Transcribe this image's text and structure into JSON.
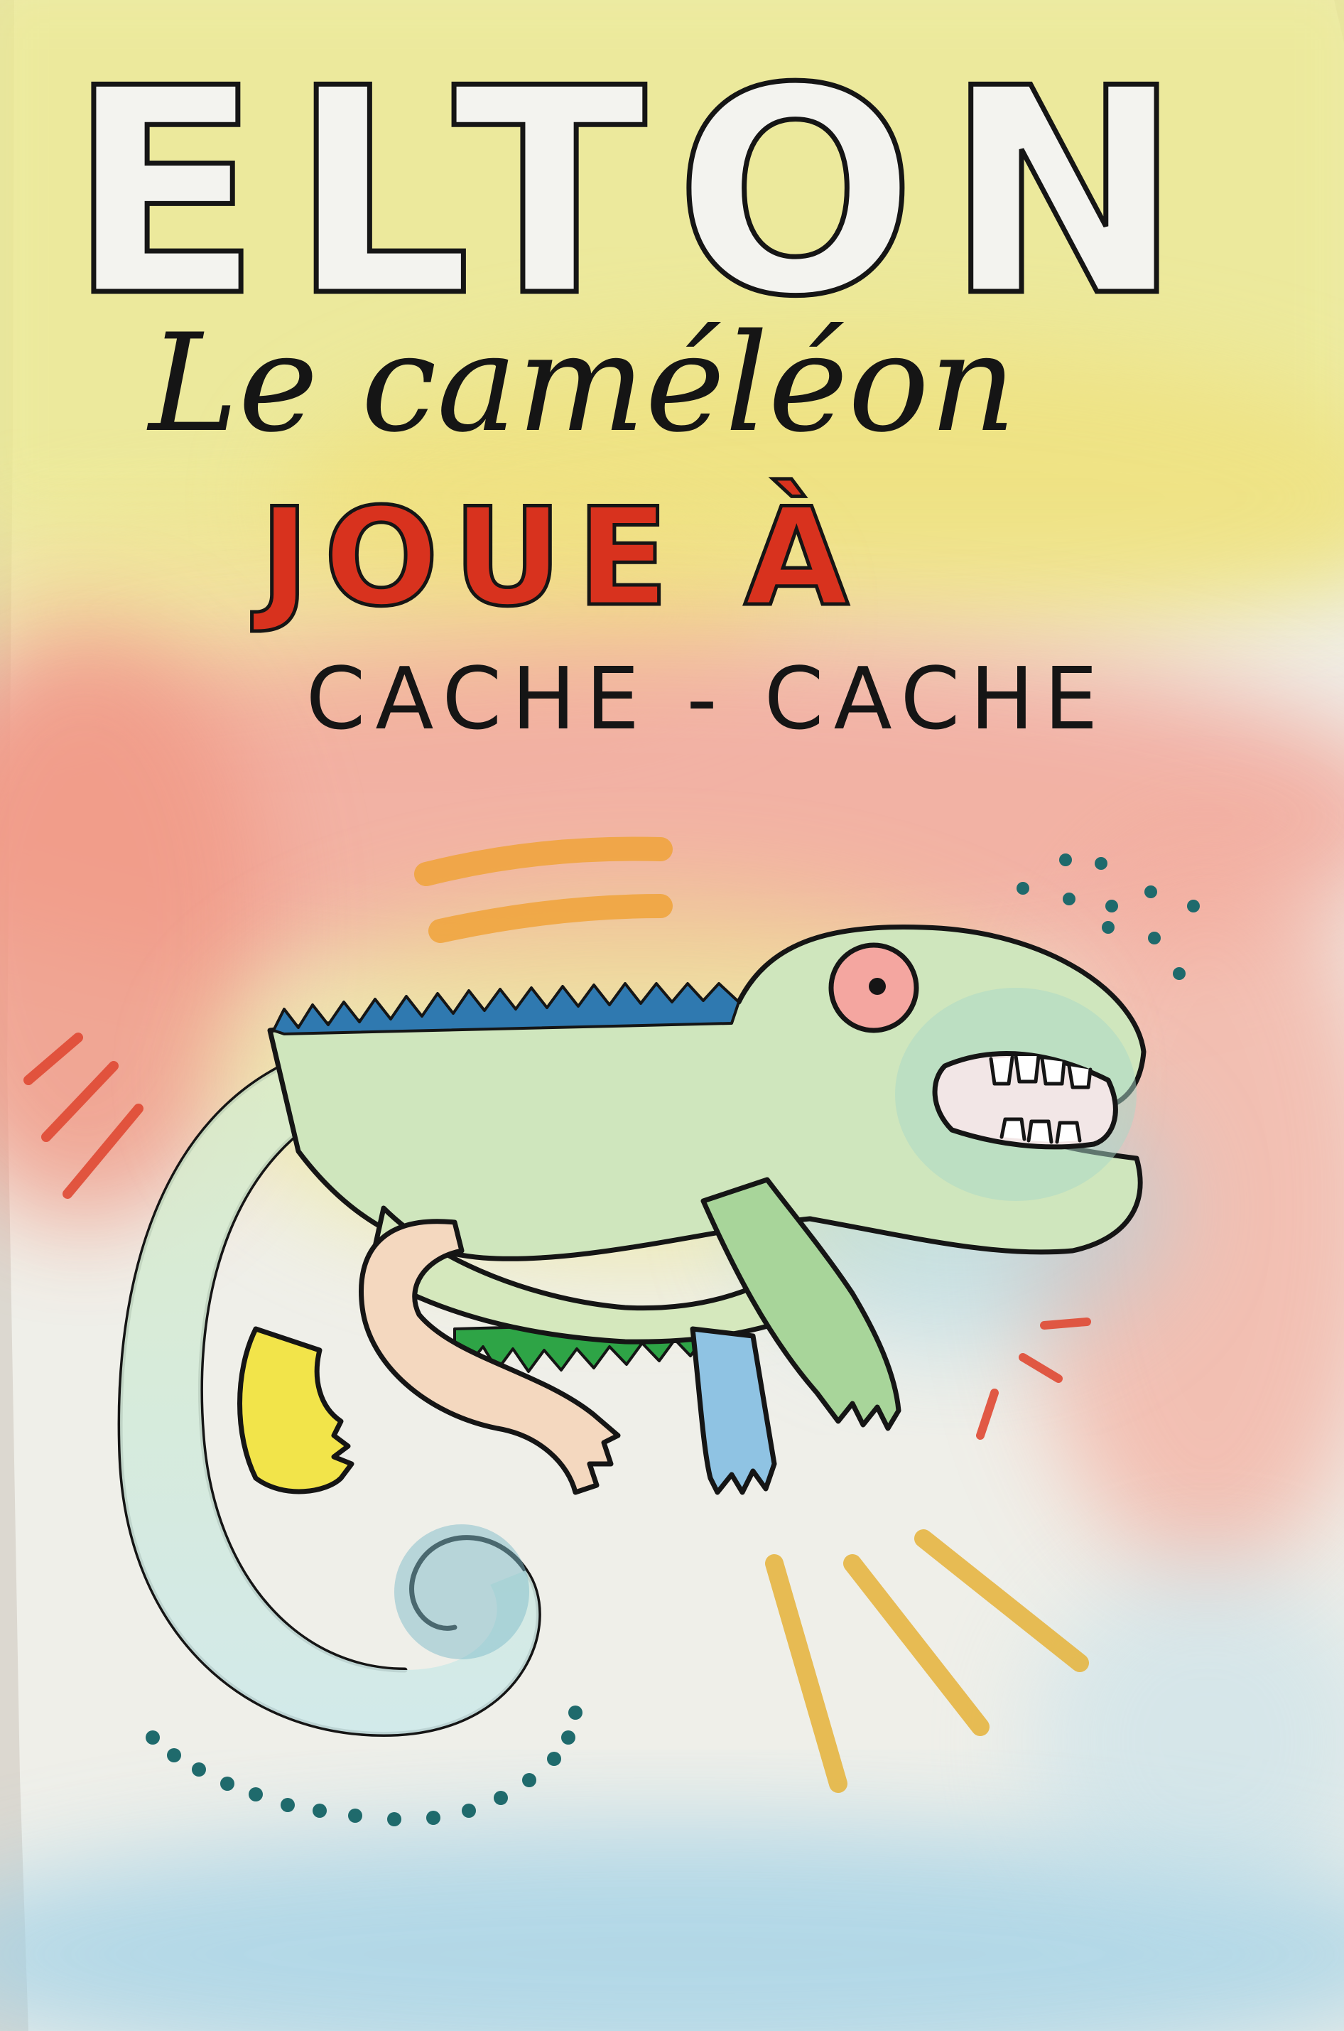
{
  "cover": {
    "title": "ELTON",
    "line2": "Le caméléon",
    "line3": "JOUE À",
    "line4": "CACHE - CACHE"
  },
  "colors": {
    "paper": "#efefe9",
    "wash_yellow": "#ece98f",
    "wash_pink": "#f3a394",
    "wash_blue": "#9fd0e6",
    "ink": "#151515",
    "title_red": "#d8321e",
    "accent_orange": "#f0a43a",
    "accent_red": "#e04a34",
    "accent_teal": "#1f6a6c",
    "crest_blue": "#2f79b0",
    "belly_green": "#2ea446",
    "body_green": "#c9e5b8",
    "eye_pink": "#f4a6a0",
    "limb_yellow": "#f2e44a"
  }
}
